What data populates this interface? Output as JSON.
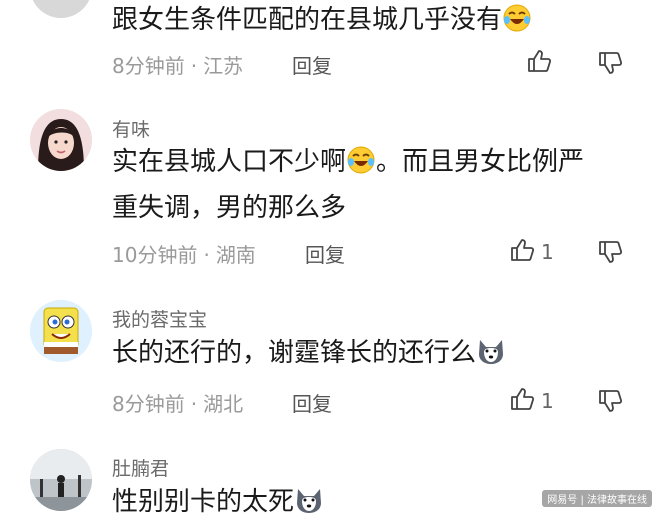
{
  "comments": [
    {
      "username": "",
      "text": "跟女生条件匹配的在县城几乎没有",
      "text_line2": "",
      "emoji": "laugh-cry-emoji",
      "time": "8分钟前",
      "location": "江苏",
      "reply": "回复",
      "likes": ""
    },
    {
      "username": "有味",
      "text": "实在县城人口不少啊",
      "text_after_emoji": "。而且男女比例严",
      "text_line2": "重失调，男的那么多",
      "emoji": "laugh-cry-emoji",
      "time": "10分钟前",
      "location": "湖南",
      "reply": "回复",
      "likes": "1"
    },
    {
      "username": "我的蓉宝宝",
      "text": "长的还行的，谢霆锋长的还行么",
      "text_line2": "",
      "emoji": "husky-dog-emoji",
      "time": "8分钟前",
      "location": "湖北",
      "reply": "回复",
      "likes": "1"
    },
    {
      "username": "肚腩君",
      "text": "性别别卡的太死",
      "text_line2": "",
      "emoji": "husky-dog-emoji",
      "time": "",
      "location": "",
      "reply": "",
      "likes": ""
    }
  ],
  "separator": "·",
  "watermark": "网易号 | 法律故事在线",
  "icons": {
    "like": "thumbs-up-icon",
    "dislike": "thumbs-down-icon"
  },
  "colors": {
    "meta": "#9a9a9a",
    "content": "#1a1a1a",
    "username": "#6b6b6b"
  }
}
